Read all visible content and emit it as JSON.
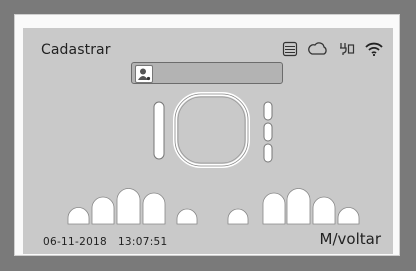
{
  "header": {
    "title": "Cadastrar",
    "status_icons": [
      "list-icon",
      "cloud-icon",
      "plug-icon",
      "wifi-icon"
    ]
  },
  "user_field": {
    "value": "",
    "icon": "user-icon"
  },
  "footer": {
    "date": "06-11-2018",
    "time": "13:07:51",
    "back_label": "M/voltar"
  }
}
